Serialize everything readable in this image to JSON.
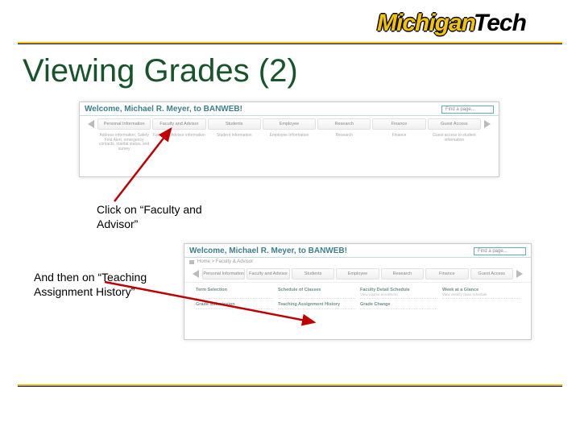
{
  "logo": {
    "part1": "Michigan",
    "part2": "Tech"
  },
  "title": "Viewing Grades (2)",
  "shot1": {
    "welcome": "Welcome, Michael R. Meyer, to BANWEB!",
    "find_placeholder": "Find a page...",
    "tabs": [
      "Personal Information",
      "Faculty and Advisor",
      "Students",
      "Employee",
      "Research",
      "Finance",
      "Guest Access"
    ],
    "subs": [
      "Address information, Safety First Alert, emergency contacts, marital status, and survey",
      "Faculty & Advisor information",
      "Student Information",
      "Employee Information",
      "Research",
      "Finance",
      "Guest access to student information"
    ]
  },
  "shot2": {
    "welcome": "Welcome, Michael R. Meyer, to BANWEB!",
    "find_placeholder": "Find a page...",
    "crumbs": "Home  >  Faculty & Advisor",
    "tabs": [
      "Personal Information",
      "Faculty and Advisor",
      "Students",
      "Employee",
      "Research",
      "Finance",
      "Guest Access"
    ],
    "links": [
      {
        "t": "Term Selection",
        "s": ""
      },
      {
        "t": "Schedule of Classes",
        "s": ""
      },
      {
        "t": "Faculty Detail Schedule",
        "s": "View course enrollment"
      },
      {
        "t": "Week at a Glance",
        "s": "View weekly class schedule"
      },
      {
        "t": "Grade Submission",
        "s": ""
      },
      {
        "t": "Teaching Assignment History",
        "s": ""
      },
      {
        "t": "Grade Change",
        "s": ""
      },
      {
        "t": "",
        "s": ""
      }
    ]
  },
  "anno1": "Click on “Faculty and Advisor”",
  "anno2": "And then on “Teaching Assignment History”"
}
